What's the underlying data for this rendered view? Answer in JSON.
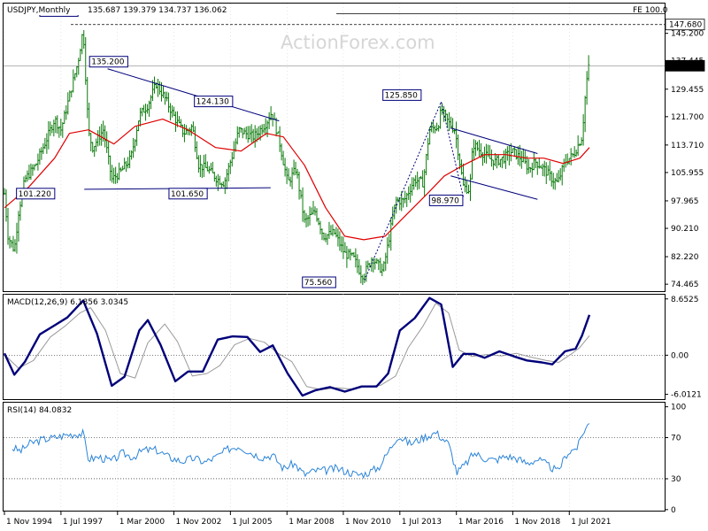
{
  "header": {
    "symbol": "USDJPY,Monthly",
    "ohlc": "135.687 139.379 134.737 136.062",
    "watermark": "ActionForex.com"
  },
  "colors": {
    "price": "#0b7a0b",
    "sma": "#e00000",
    "trendline": "#00007a",
    "macd": "#00007a",
    "signal": "#9a9a9a",
    "rsi": "#2b84d8",
    "grid": "#000000",
    "annot_border": "#00007a"
  },
  "chart_data": [
    {
      "type": "line",
      "name": "price",
      "title": "USDJPY,Monthly",
      "x_tick_labels": [
        "1 Nov 1994",
        "1 Jul 1997",
        "1 Mar 2000",
        "1 Nov 2002",
        "1 Jul 2005",
        "1 Mar 2008",
        "1 Nov 2010",
        "1 Jul 2013",
        "1 Mar 2016",
        "1 Nov 2018",
        "1 Jul 2021"
      ],
      "y_tick_labels": [
        "145.200",
        "137.445",
        "129.455",
        "121.700",
        "113.710",
        "105.955",
        "97.965",
        "90.210",
        "82.220",
        "74.465"
      ],
      "ylim": [
        72.5,
        153.6
      ],
      "grid": true,
      "series": [
        {
          "name": "USDJPY",
          "x": [
            1994.83,
            1995.0,
            1995.3,
            1995.5,
            1995.8,
            1996.3,
            1996.8,
            1997.2,
            1997.5,
            1997.8,
            1998.0,
            1998.3,
            1998.55,
            1998.8,
            1999.0,
            1999.5,
            1999.9,
            2000.3,
            2000.8,
            2001.2,
            2001.6,
            2002.0,
            2002.4,
            2002.9,
            2003.3,
            2003.7,
            2004.0,
            2004.4,
            2004.9,
            2005.2,
            2005.6,
            2005.9,
            2006.2,
            2006.6,
            2006.9,
            2007.2,
            2007.45,
            2007.8,
            2008.2,
            2008.6,
            2009.0,
            2009.5,
            2009.9,
            2010.4,
            2010.9,
            2011.3,
            2011.7,
            2011.83,
            2012.2,
            2012.7,
            2012.95,
            2013.3,
            2013.7,
            2014.2,
            2014.6,
            2014.9,
            2015.3,
            2015.45,
            2015.8,
            2016.1,
            2016.5,
            2016.8,
            2016.95,
            2017.3,
            2017.7,
            2018.0,
            2018.4,
            2018.8,
            2019.2,
            2019.6,
            2019.9,
            2020.3,
            2020.7,
            2020.95,
            2021.3,
            2021.7,
            2022.1,
            2022.3,
            2022.45
          ],
          "values": [
            100.0,
            88.0,
            84.0,
            95.0,
            104.0,
            108.0,
            115.0,
            121.0,
            118.0,
            125.0,
            130.0,
            137.0,
            146.5,
            117.0,
            113.0,
            118.0,
            104.0,
            106.0,
            110.0,
            122.0,
            125.0,
            131.0,
            127.0,
            121.0,
            117.0,
            119.0,
            108.0,
            107.0,
            104.0,
            103.0,
            111.0,
            118.0,
            117.0,
            116.0,
            118.0,
            120.0,
            123.0,
            115.0,
            103.0,
            107.0,
            92.0,
            95.0,
            88.0,
            89.0,
            83.0,
            82.0,
            77.0,
            77.5,
            82.0,
            78.0,
            86.0,
            98.0,
            98.0,
            104.0,
            103.0,
            118.0,
            119.0,
            123.5,
            120.0,
            118.0,
            102.0,
            101.0,
            114.0,
            112.0,
            110.0,
            109.0,
            110.0,
            112.0,
            110.0,
            107.0,
            109.0,
            107.0,
            104.0,
            103.0,
            109.0,
            111.0,
            116.0,
            131.0,
            137.0
          ]
        },
        {
          "name": "SMA",
          "x": [
            1994.83,
            1996.0,
            1997.2,
            1997.9,
            1998.8,
            2000.0,
            2001.0,
            2002.3,
            2003.5,
            2004.8,
            2006.0,
            2007.2,
            2008.0,
            2009.0,
            2010.0,
            2010.9,
            2011.8,
            2012.8,
            2013.8,
            2014.8,
            2015.6,
            2016.5,
            2017.5,
            2018.5,
            2019.5,
            2020.3,
            2021.2,
            2022.0,
            2022.45
          ],
          "values": [
            96.0,
            102.0,
            110.0,
            117.0,
            118.0,
            114.0,
            119.0,
            121.0,
            118.0,
            113.0,
            112.0,
            117.0,
            116.0,
            108.0,
            96.0,
            88.0,
            87.0,
            88.0,
            94.0,
            100.0,
            105.0,
            108.0,
            111.0,
            111.0,
            110.0,
            110.0,
            108.5,
            110.0,
            113.0
          ]
        }
      ]
    },
    {
      "type": "line",
      "name": "macd",
      "title": "MACD(12,26,9) 6.1856 3.0345",
      "y_tick_labels": [
        "8.6525",
        "0.00",
        "-6.0121"
      ],
      "ylim": [
        -6.75,
        9.3
      ],
      "series": [
        {
          "name": "MACD",
          "x": [
            1994.83,
            1995.3,
            1995.8,
            1996.5,
            1997.2,
            1997.8,
            1998.55,
            1999.2,
            1999.9,
            2000.5,
            2001.2,
            2001.6,
            2002.2,
            2002.9,
            2003.5,
            2004.2,
            2004.9,
            2005.6,
            2006.3,
            2006.9,
            2007.5,
            2008.2,
            2008.9,
            2009.5,
            2010.2,
            2010.9,
            2011.7,
            2012.4,
            2012.95,
            2013.5,
            2014.2,
            2014.9,
            2015.45,
            2016.0,
            2016.5,
            2017.0,
            2017.5,
            2018.2,
            2018.9,
            2019.5,
            2020.2,
            2020.7,
            2021.3,
            2021.8,
            2022.1,
            2022.45
          ],
          "values": [
            0.3,
            -3.0,
            -1.0,
            3.2,
            4.6,
            5.8,
            8.4,
            3.3,
            -4.7,
            -3.3,
            3.8,
            5.4,
            1.6,
            -4.0,
            -2.5,
            -2.5,
            2.4,
            2.9,
            2.8,
            0.5,
            1.5,
            -2.8,
            -6.2,
            -5.4,
            -4.9,
            -5.6,
            -4.8,
            -4.8,
            -2.8,
            3.8,
            5.7,
            8.8,
            7.8,
            -1.8,
            0.2,
            0.2,
            -0.4,
            0.6,
            -0.2,
            -0.8,
            -1.1,
            -1.4,
            0.6,
            1.0,
            3.0,
            6.2
          ]
        },
        {
          "name": "Signal",
          "x": [
            1994.83,
            1995.5,
            1996.2,
            1997.0,
            1997.7,
            1998.4,
            1998.9,
            1999.6,
            2000.3,
            2001.0,
            2001.6,
            2002.4,
            2003.0,
            2003.7,
            2004.4,
            2005.0,
            2005.7,
            2006.4,
            2007.1,
            2007.7,
            2008.4,
            2009.1,
            2009.8,
            2010.5,
            2011.2,
            2011.9,
            2012.6,
            2013.3,
            2013.9,
            2014.6,
            2015.2,
            2015.8,
            2016.3,
            2016.9,
            2017.6,
            2018.3,
            2019.0,
            2019.7,
            2020.4,
            2021.0,
            2021.6,
            2022.0,
            2022.45
          ],
          "values": [
            0.1,
            -2.0,
            -0.8,
            2.8,
            4.5,
            6.5,
            7.3,
            3.8,
            -2.8,
            -3.5,
            1.9,
            4.8,
            2.1,
            -3.2,
            -2.8,
            -1.6,
            1.6,
            2.6,
            2.0,
            0.4,
            -1.0,
            -4.8,
            -5.3,
            -5.0,
            -5.2,
            -4.8,
            -4.6,
            -3.2,
            1.2,
            4.5,
            8.0,
            6.5,
            0.8,
            -0.2,
            0.1,
            -0.1,
            0.3,
            -0.3,
            -0.8,
            -1.1,
            0.2,
            1.2,
            3.0
          ]
        }
      ]
    },
    {
      "type": "line",
      "name": "rsi",
      "title": "RSI(14) 84.0832",
      "y_tick_labels": [
        "100",
        "70",
        "30",
        "0"
      ],
      "ylim": [
        -1,
        104
      ],
      "series": [
        {
          "name": "RSI",
          "x": [
            1995.2,
            1995.6,
            1996.0,
            1996.6,
            1997.2,
            1997.8,
            1998.55,
            1998.8,
            1999.3,
            1999.9,
            2000.4,
            2000.9,
            2001.4,
            2002.0,
            2002.6,
            2003.2,
            2003.8,
            2004.3,
            2004.9,
            2005.4,
            2005.9,
            2006.5,
            2007.0,
            2007.5,
            2008.0,
            2008.5,
            2009.0,
            2009.5,
            2010.0,
            2010.5,
            2011.0,
            2011.5,
            2011.9,
            2012.5,
            2012.95,
            2013.4,
            2014.0,
            2014.6,
            2015.2,
            2015.8,
            2016.2,
            2016.6,
            2017.0,
            2017.5,
            2018.0,
            2018.5,
            2019.0,
            2019.5,
            2020.0,
            2020.5,
            2020.95,
            2021.4,
            2021.9,
            2022.2,
            2022.45
          ],
          "values": [
            60.0,
            57.0,
            64.0,
            68.0,
            70.0,
            73.0,
            74.0,
            49.0,
            51.0,
            47.0,
            55.0,
            51.0,
            58.0,
            58.0,
            51.0,
            47.0,
            50.0,
            46.0,
            52.0,
            59.0,
            62.0,
            55.0,
            51.0,
            53.0,
            40.0,
            45.0,
            34.0,
            38.0,
            38.0,
            40.0,
            37.0,
            34.0,
            35.0,
            41.0,
            56.0,
            72.0,
            64.0,
            70.0,
            75.0,
            64.0,
            36.0,
            44.0,
            55.0,
            50.0,
            48.0,
            52.0,
            50.0,
            45.0,
            49.0,
            43.0,
            37.0,
            55.0,
            61.0,
            77.0,
            84.0
          ]
        }
      ]
    }
  ],
  "annotations": {
    "price_labels": [
      "147.680",
      "135.200",
      "124.130",
      "125.850",
      "101.220",
      "101.650",
      "98.970",
      "75.560"
    ],
    "right_labels": [
      "147.680",
      "136.062"
    ],
    "fe_label": "FE 100.0"
  }
}
